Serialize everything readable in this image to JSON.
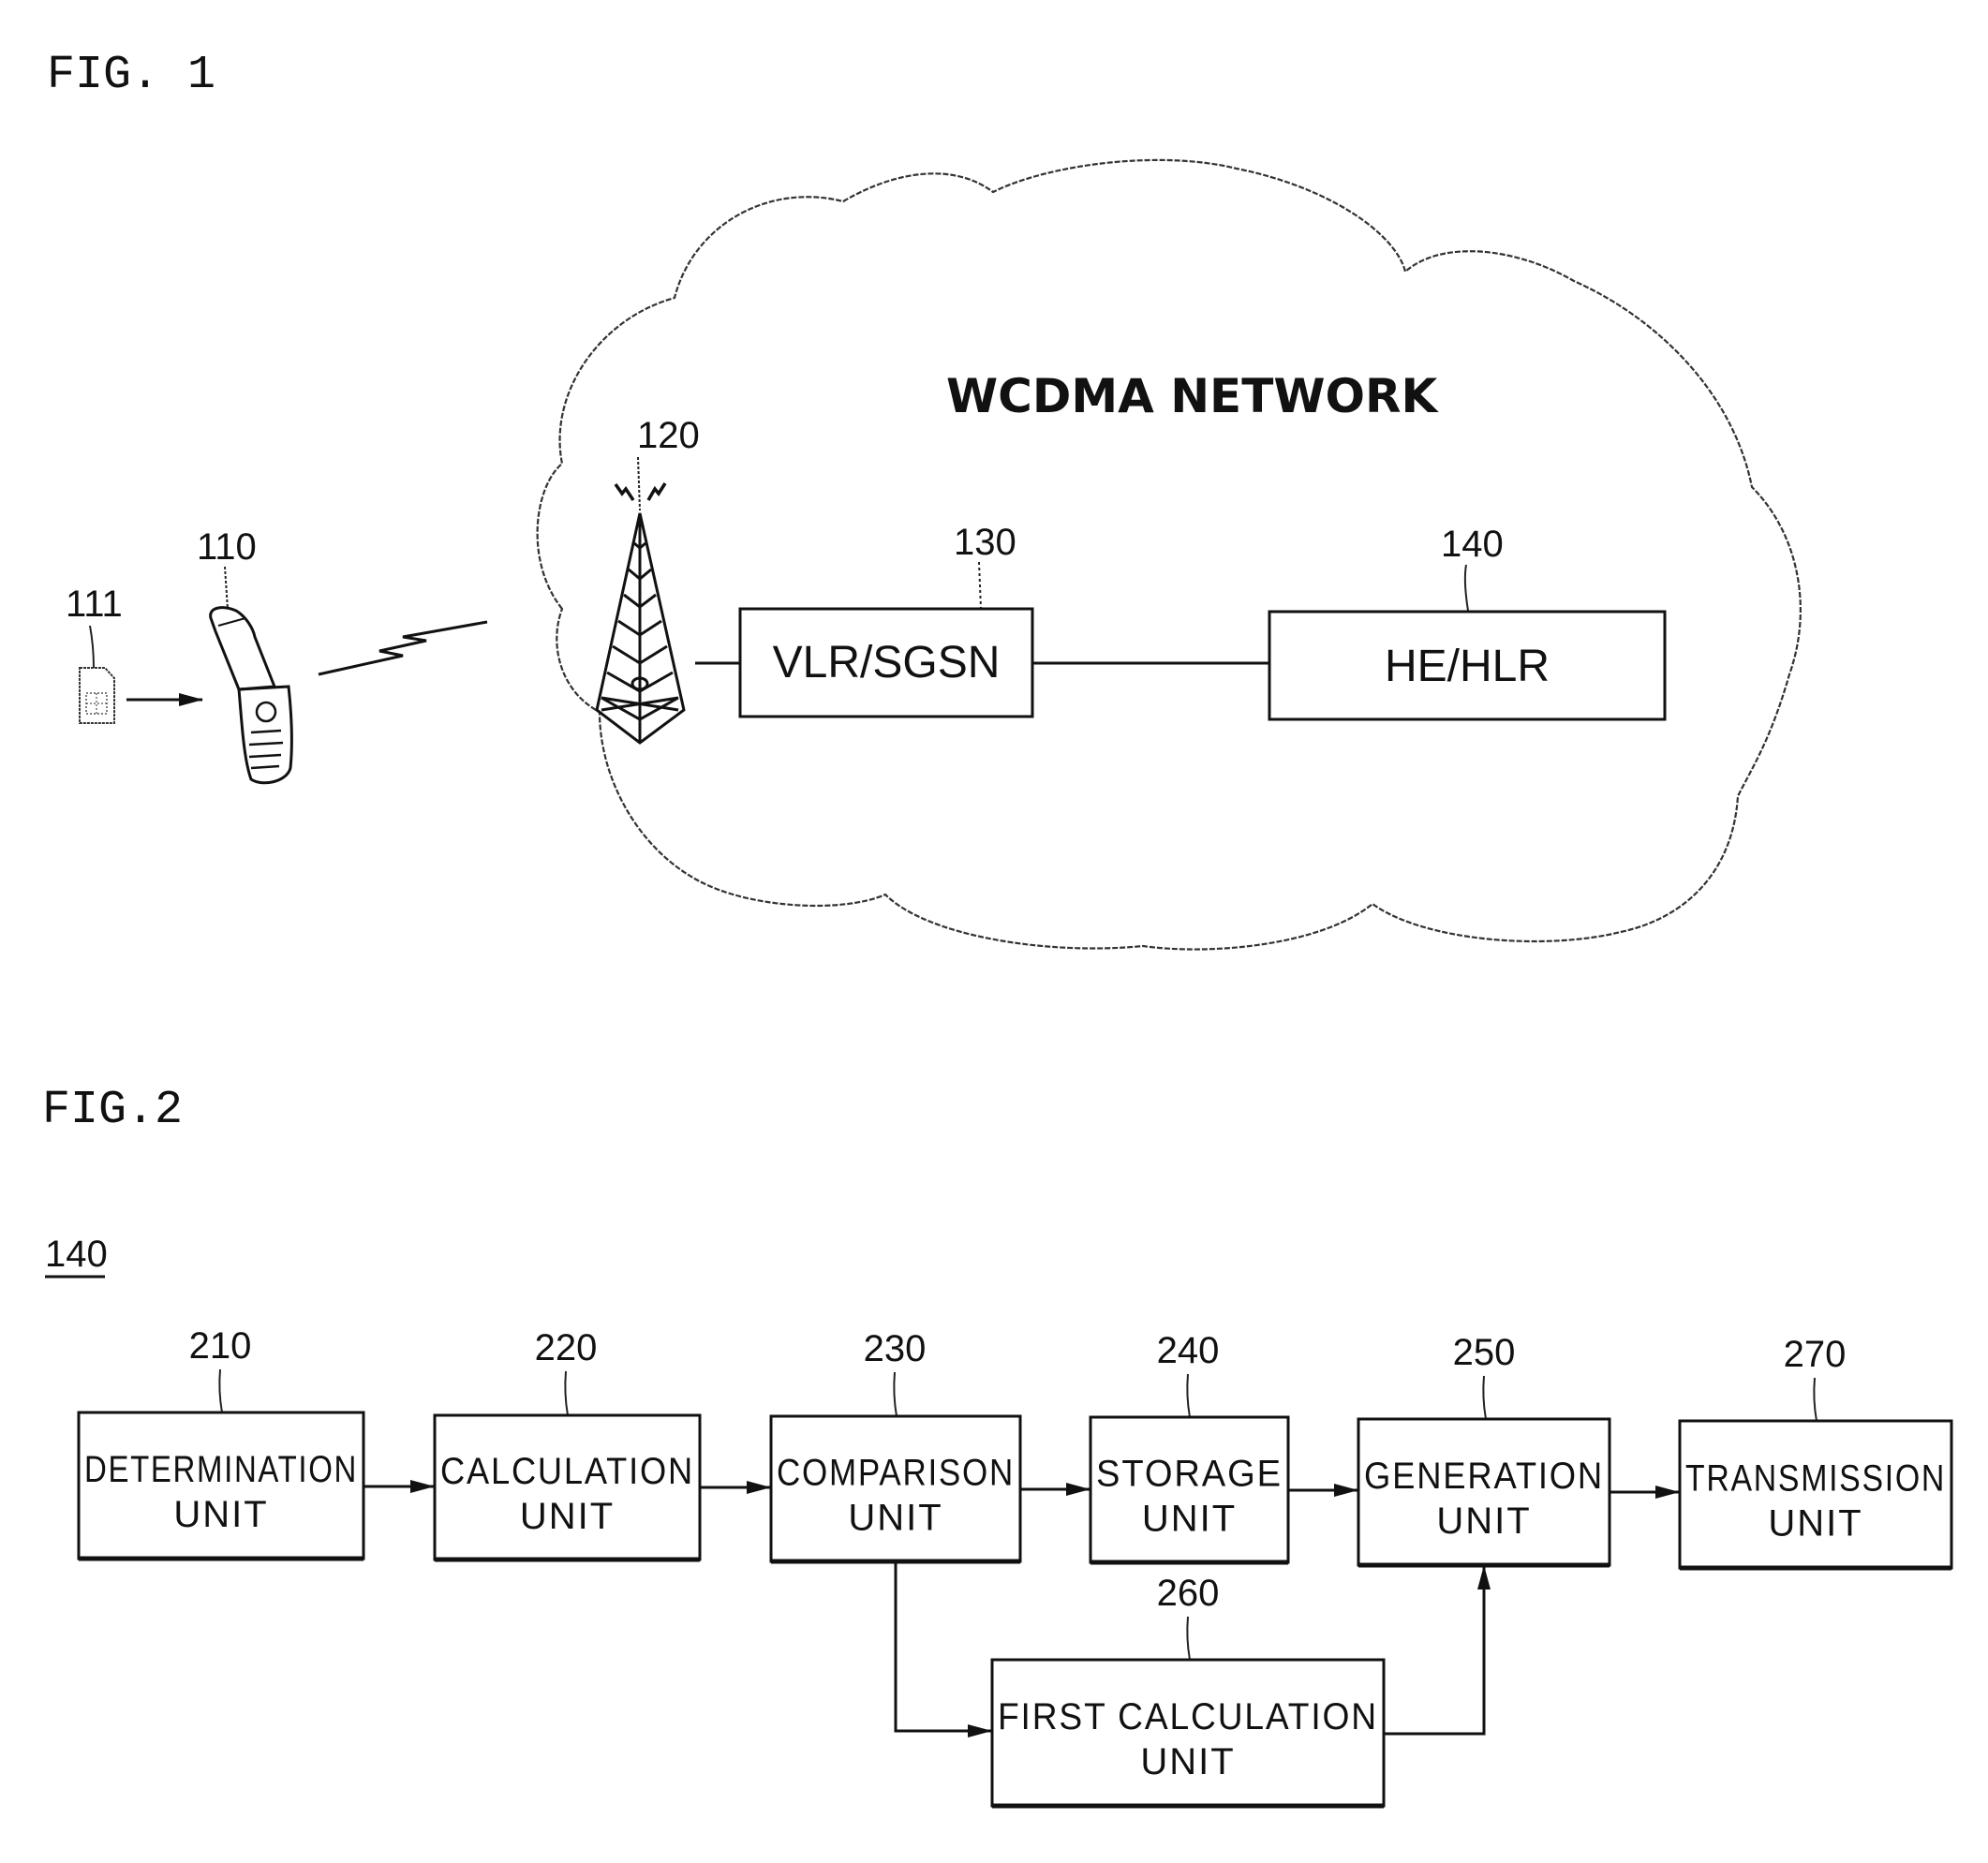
{
  "figures": {
    "fig1": {
      "title": "FIG. 1",
      "network_title": "WCDMA NETWORK",
      "nodes": [
        {
          "ref": "111",
          "name": "SIM card",
          "icon": "sim-card-icon"
        },
        {
          "ref": "110",
          "name": "Mobile phone",
          "icon": "flip-phone-icon"
        },
        {
          "ref": "120",
          "name": "Base station tower",
          "icon": "cell-tower-icon"
        },
        {
          "ref": "130",
          "label": "VLR/SGSN"
        },
        {
          "ref": "140",
          "label": "HE/HLR"
        }
      ],
      "connections": [
        {
          "from": "111",
          "to": "110",
          "type": "arrow"
        },
        {
          "from": "110",
          "to": "120",
          "type": "wireless-link"
        },
        {
          "from": "120",
          "to": "130",
          "type": "line"
        },
        {
          "from": "130",
          "to": "140",
          "type": "line"
        }
      ]
    },
    "fig2": {
      "title": "FIG.2",
      "container_ref": "140",
      "units": [
        {
          "ref": "210",
          "line1": "DETERMINATION",
          "line2": "UNIT"
        },
        {
          "ref": "220",
          "line1": "CALCULATION",
          "line2": "UNIT"
        },
        {
          "ref": "230",
          "line1": "COMPARISON",
          "line2": "UNIT"
        },
        {
          "ref": "240",
          "line1": "STORAGE",
          "line2": "UNIT"
        },
        {
          "ref": "250",
          "line1": "GENERATION",
          "line2": "UNIT"
        },
        {
          "ref": "270",
          "line1": "TRANSMISSION",
          "line2": "UNIT"
        },
        {
          "ref": "260",
          "line1": "FIRST CALCULATION",
          "line2": "UNIT"
        }
      ],
      "connections": [
        {
          "from": "210",
          "to": "220"
        },
        {
          "from": "220",
          "to": "230"
        },
        {
          "from": "230",
          "to": "240"
        },
        {
          "from": "240",
          "to": "250"
        },
        {
          "from": "250",
          "to": "270"
        },
        {
          "from": "230",
          "to": "260"
        },
        {
          "from": "260",
          "to": "250"
        }
      ]
    }
  }
}
